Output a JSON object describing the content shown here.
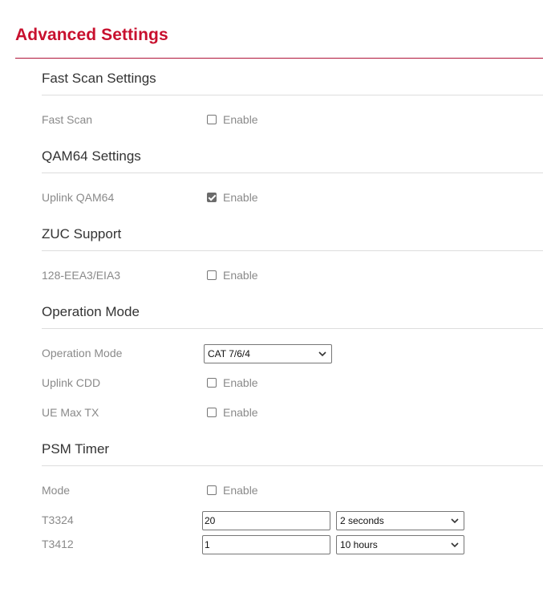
{
  "page": {
    "title": "Advanced Settings",
    "accent_color": "#c8102e"
  },
  "sections": {
    "fast_scan": {
      "title": "Fast Scan Settings",
      "rows": [
        {
          "label": "Fast Scan",
          "option_label": "Enable",
          "checked": false
        }
      ]
    },
    "qam64": {
      "title": "QAM64 Settings",
      "rows": [
        {
          "label": "Uplink QAM64",
          "option_label": "Enable",
          "checked": true
        }
      ]
    },
    "zuc": {
      "title": "ZUC Support",
      "rows": [
        {
          "label": "128-EEA3/EIA3",
          "option_label": "Enable",
          "checked": false
        }
      ]
    },
    "operation_mode": {
      "title": "Operation Mode",
      "mode_label": "Operation Mode",
      "mode_value": "CAT 7/6/4",
      "rows": [
        {
          "label": "Uplink CDD",
          "option_label": "Enable",
          "checked": false
        },
        {
          "label": "UE Max TX",
          "option_label": "Enable",
          "checked": false
        }
      ]
    },
    "psm_timer": {
      "title": "PSM Timer",
      "mode_row": {
        "label": "Mode",
        "option_label": "Enable",
        "checked": false
      },
      "t3324": {
        "label": "T3324",
        "value": "20",
        "unit": "2 seconds"
      },
      "t3412": {
        "label": "T3412",
        "value": "1",
        "unit": "10 hours"
      }
    }
  },
  "icons": {
    "dropdown": "chevron-down-icon",
    "check": "checkmark-icon"
  }
}
